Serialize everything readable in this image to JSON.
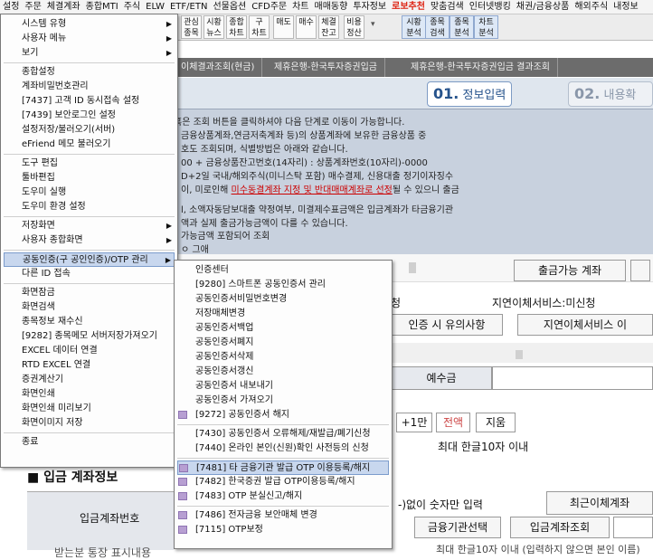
{
  "menubar": [
    "설정",
    "주문",
    "체결계좌",
    "종합MTI",
    "주식",
    "ELW",
    "ETF/ETN",
    "선물옵션",
    "CFD주문",
    "차트",
    "매매동향",
    "투자정보",
    "로보추천",
    "맞춤검색",
    "인터넷뱅킹",
    "채권/금융상품",
    "해외주식",
    "내정보"
  ],
  "toolbar": [
    {
      "l1": "관심",
      "l2": "종목"
    },
    {
      "l1": "시황",
      "l2": "뉴스"
    },
    {
      "l1": "종합",
      "l2": "차트"
    },
    {
      "l1": "구",
      "l2": "차트"
    },
    {
      "l1": "매도",
      "l2": ""
    },
    {
      "l1": "매수",
      "l2": ""
    },
    {
      "l1": "체결",
      "l2": "잔고"
    },
    {
      "l1": "비용",
      "l2": "정산"
    },
    {
      "l1": "시황",
      "l2": "분석"
    },
    {
      "l1": "종목",
      "l2": "검색"
    },
    {
      "l1": "종목",
      "l2": "분석"
    },
    {
      "l1": "차트",
      "l2": "분석"
    }
  ],
  "tabs": [
    "이체결과조회(현금)",
    "제휴은행-한국투자증권입금",
    "제휴은행-한국투자증권입금 결과조회"
  ],
  "steps": [
    {
      "num": "01.",
      "label": "정보입력"
    },
    {
      "num": "02.",
      "label": "내용확인"
    }
  ],
  "info": {
    "l1": "혹은 조회 버튼을 클릭하셔야 다음 단계로 이동이 가능합니다.",
    "l2": "금융상품계좌,연금저축계좌 등)의 상품계좌에 보유한 금융상품 중",
    "l3": "호도 조회되며, 식별방법은 아래와 같습니다.",
    "l4": "00 + 금융상품잔고번호(14자리) : 상품계좌번호(10자리)-0000",
    "l5": "D+2일 국내/해외주식(미니스탁 포함) 매수결제, 신용대출 정기이자징수",
    "l6a": "이, 미로인해 ",
    "l6b": "미수동결계좌 지정 및 반대매매계좌로 선정",
    "l6c": "될 수 있으니 출금",
    "l7": "l, 소액자동담보대출 약정여부, 미결제수표금액은 입금계좌가 타금융기관",
    "l8": "액과 실제 출금가능금액이 다를 수 있습니다.",
    "l9": "가능금액 포함되어 조회",
    "l10": "ㅇ 그애"
  },
  "content": {
    "withdrawable_btn": "출금가능 계좌",
    "delay_status": "지연이체서비스:미신청",
    "cert_notice_btn": "인증 시 유의사항",
    "delay_service_btn": "지연이체서비스 이",
    "deposit_label": "예수금",
    "plus_1man": "+1만",
    "all_amount": "전액",
    "clear_btn": "지움",
    "max_hangul": "최대 한글10자 이내",
    "section_title": "■ 입금 계좌정보",
    "deposit_account_no": "입금계좌번호",
    "digits_only": "-)없이 숫자만 입력",
    "recent_btn": "최근이체계좌",
    "bank_select_btn": "금융기관선택",
    "account_lookup_btn": "입금계좌조회",
    "passbook_label": "받는분 통장 표시내용",
    "max_hangul2": "최대 한글10자 이내 (입력하지 않으면 본인 이름)",
    "chung": "청"
  },
  "main_menu": [
    {
      "label": "시스템 유형",
      "arrow": true
    },
    {
      "label": "사용자 메뉴",
      "arrow": true
    },
    {
      "label": "보기",
      "arrow": true
    },
    {
      "sep": true
    },
    {
      "label": "종합설정"
    },
    {
      "label": "계좌비밀번호관리"
    },
    {
      "label": "[7437] 고객 ID 동시접속 설정"
    },
    {
      "label": "[7439] 보안로그인 설정"
    },
    {
      "label": "설정저장/불러오기(서버)"
    },
    {
      "label": "eFriend 메모 불러오기"
    },
    {
      "sep": true
    },
    {
      "label": "도구 편집"
    },
    {
      "label": "툴바편집"
    },
    {
      "label": "도우미 실행"
    },
    {
      "label": "도우미 환경 설정"
    },
    {
      "sep": true
    },
    {
      "label": "저장화면",
      "arrow": true
    },
    {
      "label": "사용자 종합화면",
      "arrow": true
    },
    {
      "sep": true
    },
    {
      "label": "공동인증(구 공인인증)/OTP 관리",
      "arrow": true,
      "active": true
    },
    {
      "label": "다른 ID 접속"
    },
    {
      "sep": true
    },
    {
      "label": "화면잠금"
    },
    {
      "label": "화면검색"
    },
    {
      "label": "종목정보 재수신"
    },
    {
      "label": "[9282] 종목메모 서버저장가져오기"
    },
    {
      "label": "EXCEL 데이터 연결"
    },
    {
      "label": "RTD EXCEL 연결"
    },
    {
      "label": "증권계산기"
    },
    {
      "label": "화면인쇄"
    },
    {
      "label": "화면인쇄 미리보기"
    },
    {
      "label": "화면이미지 저장"
    },
    {
      "sep": true
    },
    {
      "label": "종료"
    }
  ],
  "sub_menu": [
    {
      "label": "인증센터"
    },
    {
      "label": "[9280] 스마트폰 공동인증서 관리"
    },
    {
      "label": "공동인증서비밀번호변경"
    },
    {
      "label": "저장매체변경"
    },
    {
      "label": "공동인증서백업"
    },
    {
      "label": "공동인증서폐지"
    },
    {
      "label": "공동인증서삭제"
    },
    {
      "label": "공동인증서갱신"
    },
    {
      "label": "공동인증서 내보내기"
    },
    {
      "label": "공동인증서 가져오기"
    },
    {
      "label": "[9272] 공동인증서 해지",
      "icon": true
    },
    {
      "sep": true
    },
    {
      "label": "[7430] 공동인증서 오류해제/재발급/폐기신청"
    },
    {
      "label": "[7440] 온라인 본인(신원)확인 사전등의 신청"
    },
    {
      "sep": true
    },
    {
      "label": "[7481] 타 금융기관 발급 OTP 이용등록/해지",
      "icon": true,
      "hi": true
    },
    {
      "label": "[7482] 한국증권 발급 OTP이용등록/해지",
      "icon": true
    },
    {
      "label": "[7483] OTP 분실신고/해지",
      "icon": true
    },
    {
      "sep": true
    },
    {
      "label": "[7486] 전자금융 보안매체 변경",
      "icon": true
    },
    {
      "label": "[7115] OTP보정",
      "icon": true
    }
  ],
  "icons": {
    "arrow": "▶",
    "checkbox": "☐"
  }
}
